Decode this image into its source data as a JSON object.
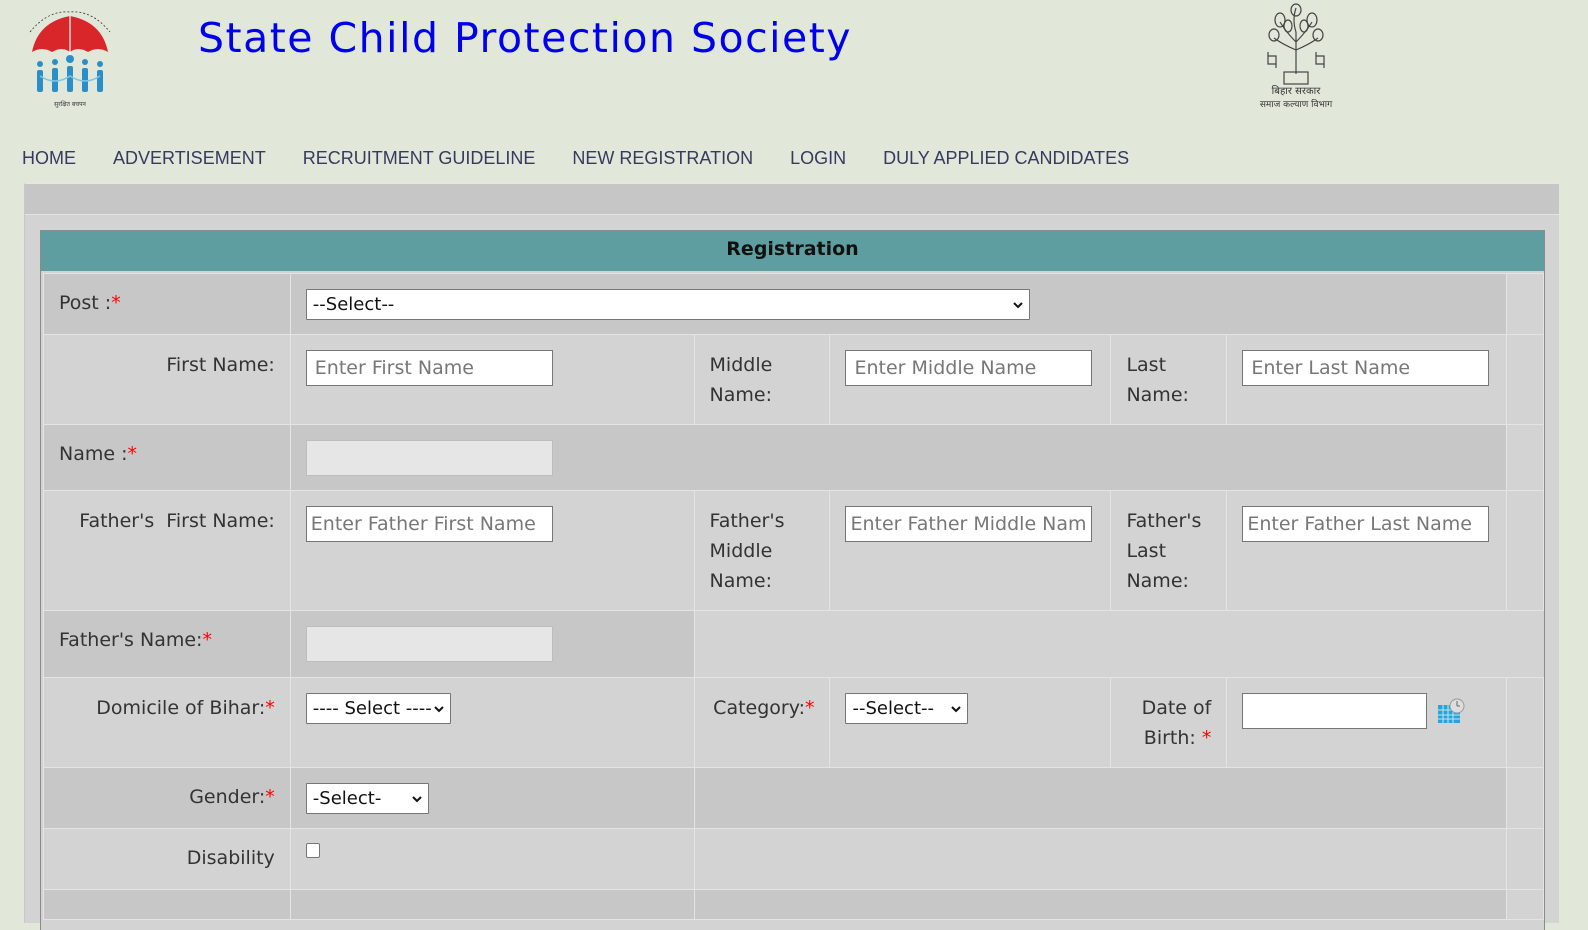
{
  "header": {
    "title": "State Child Protection Society",
    "left_logo": "scps-umbrella-logo",
    "right_logo": "bihar-sarkar-emblem",
    "right_logo_text_1": "बिहार सरकार",
    "right_logo_text_2": "समाज कल्याण विभाग"
  },
  "nav": {
    "items": [
      {
        "label": "HOME"
      },
      {
        "label": "ADVERTISEMENT"
      },
      {
        "label": "RECRUITMENT GUIDELINE"
      },
      {
        "label": "NEW REGISTRATION"
      },
      {
        "label": "LOGIN"
      },
      {
        "label": "DULY APPLIED CANDIDATES"
      }
    ]
  },
  "form": {
    "heading": "Registration",
    "required_mark": "*",
    "post": {
      "label": "Post :",
      "value": "--Select--"
    },
    "first_name": {
      "label": "First Name:",
      "placeholder": "Enter First Name"
    },
    "middle_name": {
      "label": "Middle Name:",
      "placeholder": "Enter Middle Name"
    },
    "last_name": {
      "label": "Last Name:",
      "placeholder": "Enter Last Name"
    },
    "name": {
      "label": "Name :",
      "value": ""
    },
    "father_first_name": {
      "label": "Father's  First Name:",
      "placeholder": "Enter Father First Name"
    },
    "father_middle_name": {
      "label": "Father's Middle Name:",
      "placeholder": "Enter Father Middle Name"
    },
    "father_last_name": {
      "label": "Father's Last Name:",
      "placeholder": "Enter Father Last Name"
    },
    "father_name": {
      "label": "Father's Name:",
      "value": ""
    },
    "domicile": {
      "label": "Domicile of Bihar:",
      "value": "---- Select ----"
    },
    "category": {
      "label": "Category:",
      "value": "--Select--"
    },
    "dob": {
      "label": "Date of Birth: ",
      "value": "",
      "icon": "calendar-icon"
    },
    "gender": {
      "label": "Gender:",
      "value": "-Select-"
    },
    "disability": {
      "label": "Disability",
      "checked": false
    }
  }
}
